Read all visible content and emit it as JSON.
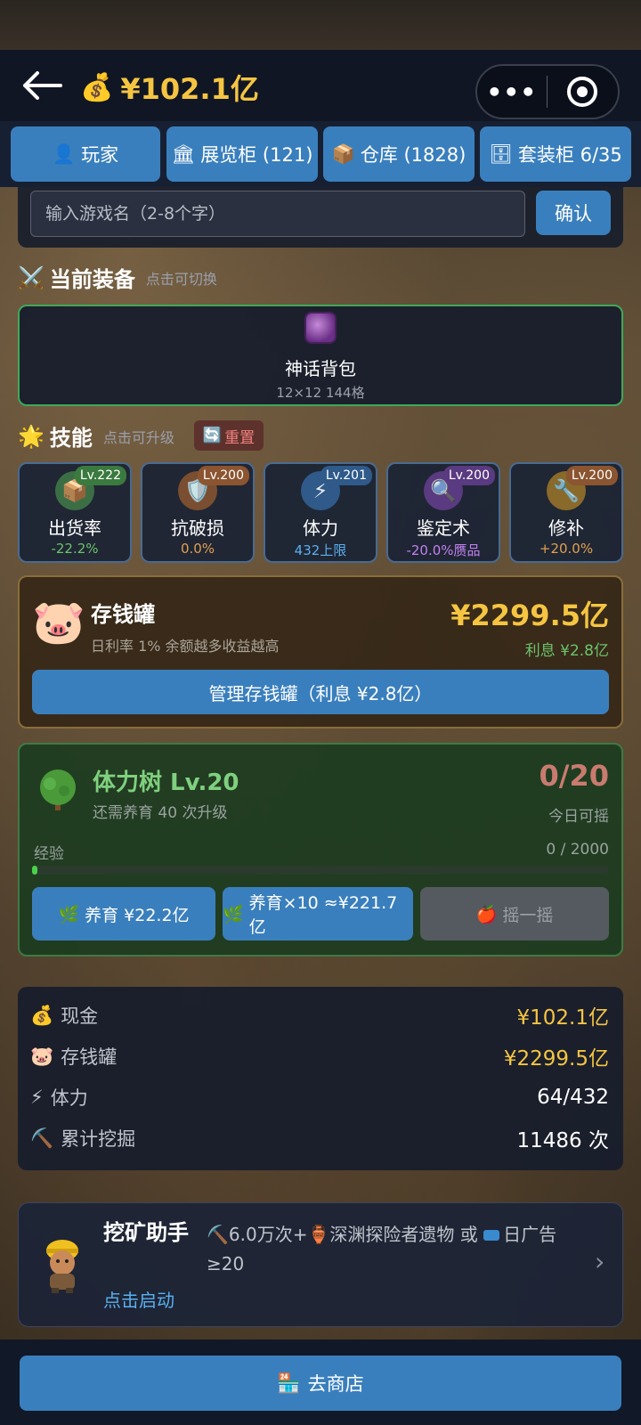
{
  "header": {
    "title": "¥102.1亿",
    "icon": "money-bag-icon"
  },
  "tabs": [
    {
      "icon": "person-icon",
      "label": "玩家"
    },
    {
      "icon": "museum-icon",
      "label": "展览柜 (121)"
    },
    {
      "icon": "box-icon",
      "label": "仓库 (1828)"
    },
    {
      "icon": "cabinet-icon",
      "label": "套装柜 6/35"
    }
  ],
  "name_input": {
    "placeholder": "输入游戏名（2-8个字）",
    "confirm": "确认"
  },
  "equipment": {
    "heading": "当前装备",
    "hint": "点击可切换",
    "item": {
      "name": "神话背包",
      "size": "12×12 144格",
      "icon": "backpack-icon"
    }
  },
  "skills": {
    "heading": "技能",
    "hint": "点击可升级",
    "reset": "重置",
    "items": [
      {
        "name": "出货率",
        "level": "Lv.222",
        "value": "-22.2%",
        "icon": "package-icon",
        "color": "#6cc36c"
      },
      {
        "name": "抗破损",
        "level": "Lv.200",
        "value": "0.0%",
        "icon": "shield-icon",
        "color": "#e0a050"
      },
      {
        "name": "体力",
        "level": "Lv.201",
        "value": "432上限",
        "icon": "lightning-icon",
        "color": "#5ab0f0"
      },
      {
        "name": "鉴定术",
        "level": "Lv.200",
        "value": "-20.0%赝品",
        "icon": "magnifier-icon",
        "color": "#c080f0"
      },
      {
        "name": "修补",
        "level": "Lv.200",
        "value": "+20.0%",
        "icon": "wrench-icon",
        "color": "#e0a050"
      }
    ]
  },
  "piggy_bank": {
    "title": "存钱罐",
    "desc": "日利率 1%  余额越多收益越高",
    "amount": "¥2299.5亿",
    "interest": "利息 ¥2.8亿",
    "button": "管理存钱罐（利息 ¥2.8亿）"
  },
  "stamina_tree": {
    "title": "体力树  Lv.20",
    "sub": "还需养育 40 次升级",
    "count": "0/20",
    "today": "今日可摇",
    "exp_label": "经验",
    "exp_value": "0 / 2000",
    "exp_fraction": 0,
    "btn_nurture": "养育 ¥22.2亿",
    "btn_nurture10": "养育×10 ≈¥221.7亿",
    "btn_shake": "摇一摇"
  },
  "stats": [
    {
      "icon": "money-bag-icon",
      "label": "现金",
      "value": "¥102.1亿",
      "color": "#f5c542"
    },
    {
      "icon": "pig-icon",
      "label": "存钱罐",
      "value": "¥2299.5亿",
      "color": "#f5c542"
    },
    {
      "icon": "lightning-icon",
      "label": "体力",
      "value": "64/432",
      "color": "#ffffff"
    },
    {
      "icon": "pickaxe-icon",
      "label": "累计挖掘",
      "value": "11486 次",
      "color": "#ffffff"
    }
  ],
  "mining_assistant": {
    "title": "挖矿助手",
    "action": "点击启动",
    "req_a": "6.0万次+",
    "req_b": "深渊探险者遗物 或 ",
    "req_c": "日广告≥20"
  },
  "shop_button": "去商店"
}
